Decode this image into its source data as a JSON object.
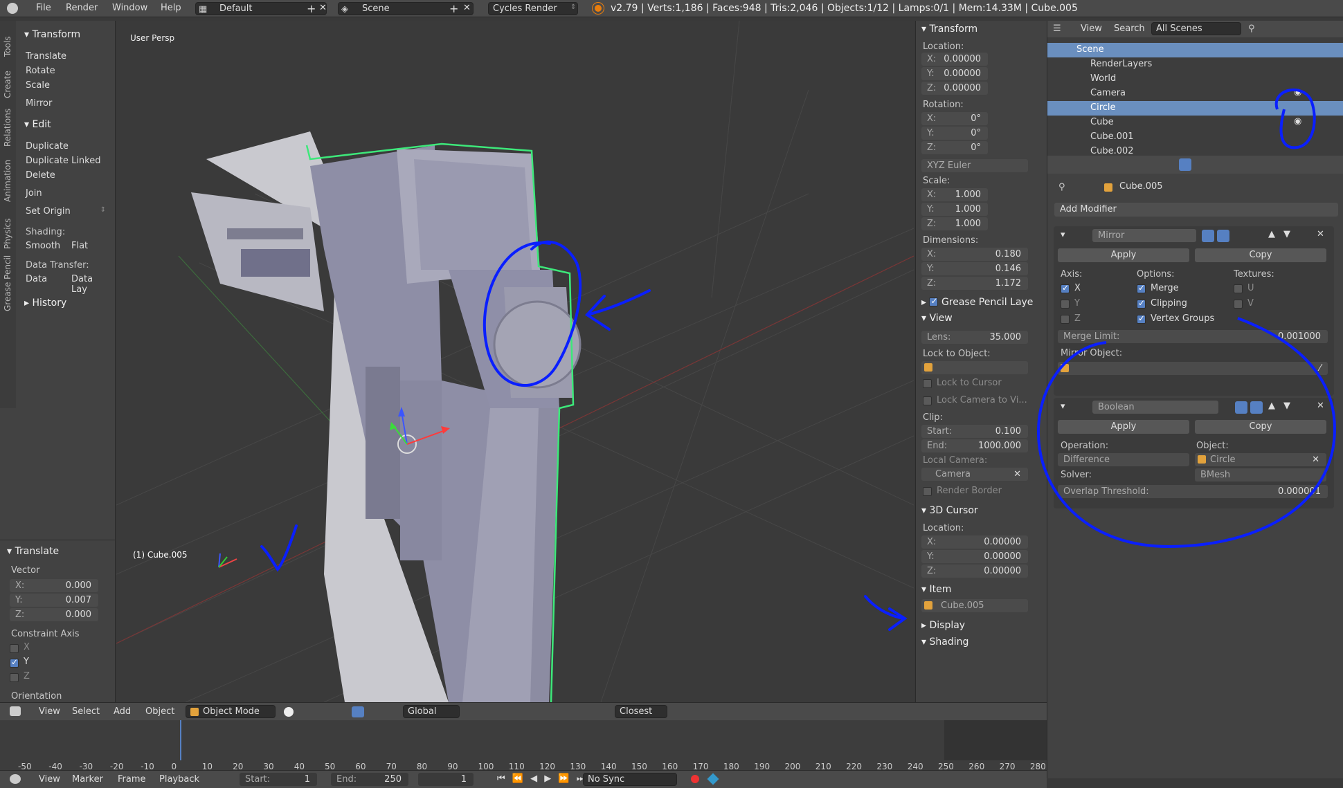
{
  "topbar": {
    "menus": [
      "File",
      "Render",
      "Window",
      "Help"
    ],
    "layout": "Default",
    "scene": "Scene",
    "engine": "Cycles Render",
    "stats": "v2.79 | Verts:1,186 | Faces:948 | Tris:2,046 | Objects:1/12 | Lamps:0/1 | Mem:14.33M | Cube.005"
  },
  "vtabs": [
    "Tools",
    "Create",
    "Relations",
    "Animation",
    "Physics",
    "Grease Pencil"
  ],
  "toolshelf": {
    "transform_title": "Transform",
    "transform": [
      "Translate",
      "Rotate",
      "Scale"
    ],
    "mirror": "Mirror",
    "edit_title": "Edit",
    "edit": [
      "Duplicate",
      "Duplicate Linked",
      "Delete"
    ],
    "join": "Join",
    "set_origin": "Set Origin",
    "shading_label": "Shading:",
    "smooth": "Smooth",
    "flat": "Flat",
    "data_transfer_label": "Data Transfer:",
    "data": "Data",
    "data_lay": "Data Lay",
    "history": "History"
  },
  "operator": {
    "title": "Translate",
    "vector_label": "Vector",
    "x": "X:",
    "xv": "0.000",
    "y": "Y:",
    "yv": "0.007",
    "z": "Z:",
    "zv": "0.000",
    "constraint_label": "Constraint Axis",
    "cx": "X",
    "cy": "Y",
    "cz": "Z",
    "orientation": "Orientation"
  },
  "viewport": {
    "view_label": "User Persp",
    "object_label": "(1) Cube.005"
  },
  "npanel": {
    "transform": "Transform",
    "location": "Location:",
    "loc": [
      "0.00000",
      "0.00000",
      "0.00000"
    ],
    "rotation": "Rotation:",
    "rot": [
      "0°",
      "0°",
      "0°"
    ],
    "euler": "XYZ Euler",
    "scale": "Scale:",
    "scl": [
      "1.000",
      "1.000",
      "1.000"
    ],
    "dimensions": "Dimensions:",
    "dims": [
      "0.180",
      "0.146",
      "1.172"
    ],
    "axes": [
      "X:",
      "Y:",
      "Z:"
    ],
    "grease": "Grease Pencil Laye",
    "view": "View",
    "lens_l": "Lens:",
    "lens": "35.000",
    "lock_obj": "Lock to Object:",
    "lock_cursor": "Lock to Cursor",
    "lock_camera": "Lock Camera to Vi...",
    "clip": "Clip:",
    "start_l": "Start:",
    "start": "0.100",
    "end_l": "End:",
    "end": "1000.000",
    "local_cam": "Local Camera:",
    "camera": "Camera",
    "render_border": "Render Border",
    "cursor3d": "3D Cursor",
    "cur_location": "Location:",
    "cur": [
      "0.00000",
      "0.00000",
      "0.00000"
    ],
    "item": "Item",
    "item_name": "Cube.005",
    "display": "Display",
    "shading": "Shading"
  },
  "outliner": {
    "view": "View",
    "search": "Search",
    "scenes": "All Scenes",
    "rows": [
      "Scene",
      "RenderLayers",
      "World",
      "Camera",
      "Circle",
      "Cube",
      "Cube.001",
      "Cube.002"
    ]
  },
  "props": {
    "object": "Cube.005",
    "add_modifier": "Add Modifier",
    "mirror": {
      "name": "Mirror",
      "apply": "Apply",
      "copy": "Copy",
      "axis": "Axis:",
      "options": "Options:",
      "textures": "Textures:",
      "x": "X",
      "y": "Y",
      "z": "Z",
      "merge": "Merge",
      "clipping": "Clipping",
      "vgroups": "Vertex Groups",
      "u": "U",
      "v": "V",
      "merge_limit_l": "Merge Limit:",
      "merge_limit": "0.001000",
      "mirror_obj": "Mirror Object:"
    },
    "boolean": {
      "name": "Boolean",
      "apply": "Apply",
      "copy": "Copy",
      "operation_l": "Operation:",
      "operation": "Difference",
      "object_l": "Object:",
      "object": "Circle",
      "solver_l": "Solver:",
      "solver": "BMesh",
      "overlap_l": "Overlap Threshold:",
      "overlap": "0.000001"
    }
  },
  "vheader": {
    "view": "View",
    "select": "Select",
    "add": "Add",
    "object": "Object",
    "mode": "Object Mode",
    "orientation": "Global",
    "snap": "Closest"
  },
  "timeline": {
    "ticks": [
      "-50",
      "-40",
      "-30",
      "-20",
      "-10",
      "0",
      "10",
      "20",
      "30",
      "40",
      "50",
      "60",
      "70",
      "80",
      "90",
      "100",
      "110",
      "120",
      "130",
      "140",
      "150",
      "160",
      "170",
      "180",
      "190",
      "200",
      "210",
      "220",
      "230",
      "240",
      "250",
      "260",
      "270",
      "280"
    ]
  },
  "tlheader": {
    "view": "View",
    "marker": "Marker",
    "frame": "Frame",
    "playback": "Playback",
    "start_l": "Start:",
    "start": "1",
    "end_l": "End:",
    "end": "250",
    "current": "1",
    "sync": "No Sync"
  },
  "colors": {
    "accent": "#5680c2",
    "selection": "#6a8fbf",
    "annotation": "#0a1fff",
    "object_outline": "#3de87a"
  }
}
